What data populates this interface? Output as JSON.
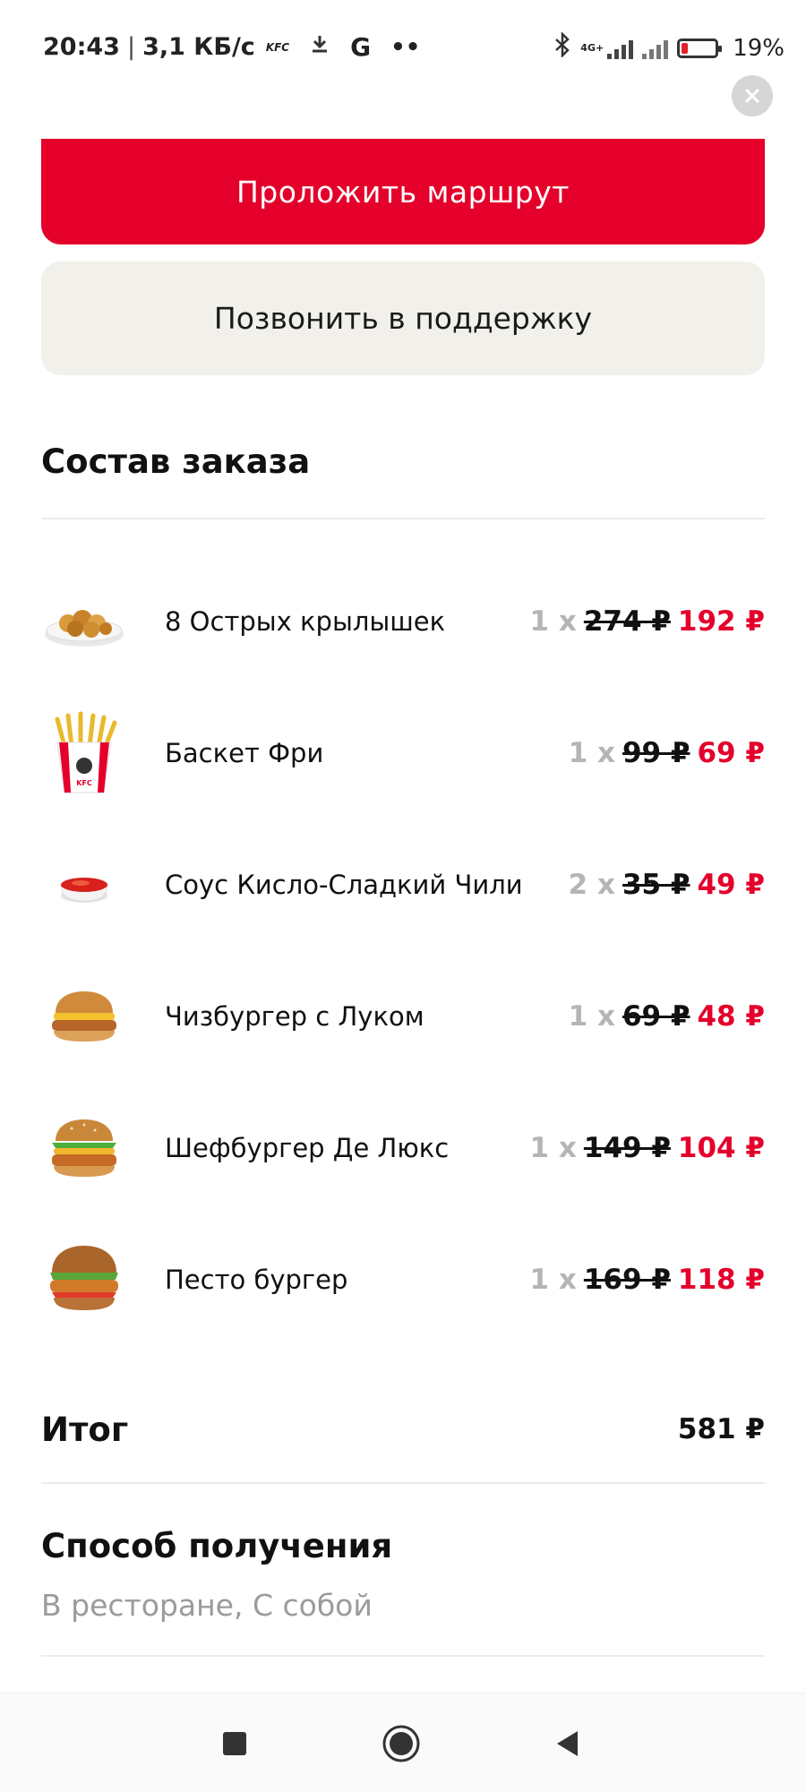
{
  "status_bar": {
    "time": "20:43",
    "speed": "3,1 КБ/с",
    "app_badge": "KFC",
    "network": "4G+",
    "battery_text": "19%",
    "battery_level": 0.19
  },
  "actions": {
    "route_label": "Проложить маршрут",
    "support_label": "Позвонить в поддержку"
  },
  "order": {
    "title": "Состав заказа",
    "items": [
      {
        "name": "8 Острых крылышек",
        "qty": "1 x",
        "old_price": "274 ₽",
        "price": "192 ₽",
        "icon": "wings-icon"
      },
      {
        "name": "Баскет Фри",
        "qty": "1 x",
        "old_price": "99 ₽",
        "price": "69 ₽",
        "icon": "fries-basket-icon"
      },
      {
        "name": "Соус Кисло-Сладкий Чили",
        "qty": "2 x",
        "old_price": "35 ₽",
        "price": "49 ₽",
        "icon": "sauce-icon"
      },
      {
        "name": "Чизбургер с Луком",
        "qty": "1 x",
        "old_price": "69 ₽",
        "price": "48 ₽",
        "icon": "cheeseburger-icon"
      },
      {
        "name": "Шефбургер Де Люкс",
        "qty": "1 x",
        "old_price": "149 ₽",
        "price": "104 ₽",
        "icon": "chefburger-icon"
      },
      {
        "name": "Песто бургер",
        "qty": "1 x",
        "old_price": "169 ₽",
        "price": "118 ₽",
        "icon": "pesto-burger-icon"
      }
    ]
  },
  "total": {
    "label": "Итог",
    "value": "581 ₽"
  },
  "pickup": {
    "title": "Способ получения",
    "value": "В ресторане, С собой"
  },
  "colors": {
    "accent": "#e4002b",
    "support_bg": "#f2f0ea",
    "muted": "#9b9b9b"
  }
}
